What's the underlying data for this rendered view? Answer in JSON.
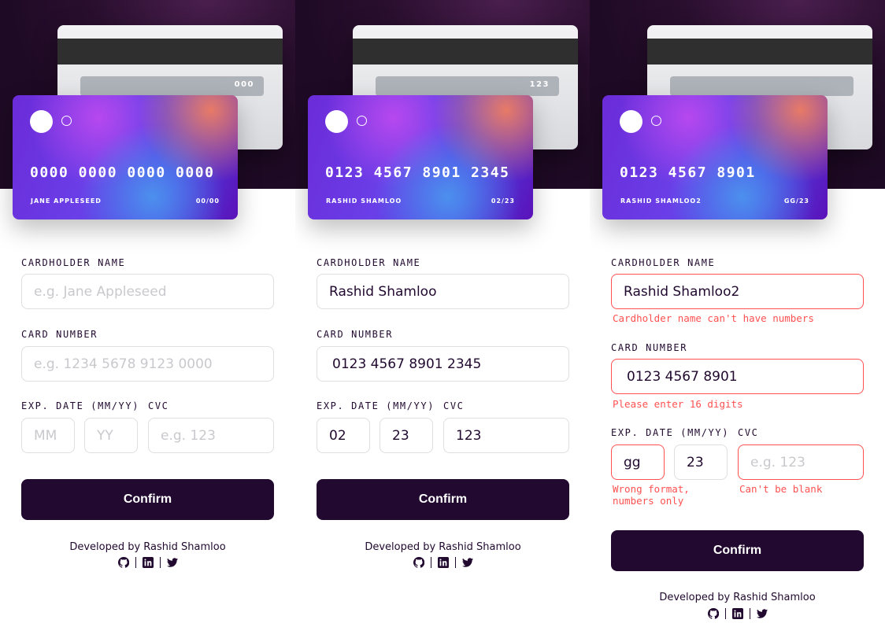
{
  "panels": [
    {
      "card_back_cvc": "000",
      "card_number": "0000 0000 0000 0000",
      "card_holder": "JANE APPLESEED",
      "card_expiry": "00/00",
      "name_label": "CARDHOLDER NAME",
      "name_value": "",
      "name_placeholder": "e.g. Jane Appleseed",
      "number_label": "CARD NUMBER",
      "number_value": "",
      "number_placeholder": "e.g. 1234 5678 9123 0000",
      "exp_label": "EXP. DATE (MM/YY)",
      "mm_value": "",
      "mm_placeholder": "MM",
      "yy_value": "",
      "yy_placeholder": "YY",
      "cvc_label": "CVC",
      "cvc_value": "",
      "cvc_placeholder": "e.g. 123",
      "confirm_label": "Confirm",
      "footer_text": "Developed by Rashid Shamloo"
    },
    {
      "card_back_cvc": "123",
      "card_number": "0123 4567 8901 2345",
      "card_holder": "RASHID SHAMLOO",
      "card_expiry": "02/23",
      "name_label": "CARDHOLDER NAME",
      "name_value": "Rashid Shamloo",
      "number_label": "CARD NUMBER",
      "number_value": "0123 4567 8901 2345",
      "exp_label": "EXP. DATE (MM/YY)",
      "mm_value": "02",
      "yy_value": "23",
      "cvc_label": "CVC",
      "cvc_value": "123",
      "confirm_label": "Confirm",
      "footer_text": "Developed by Rashid Shamloo"
    },
    {
      "card_back_cvc": "",
      "card_number": "0123 4567 8901",
      "card_holder": "RASHID SHAMLOO2",
      "card_expiry": "GG/23",
      "name_label": "CARDHOLDER NAME",
      "name_value": "Rashid Shamloo2",
      "name_error": "Cardholder name can't have numbers",
      "number_label": "CARD NUMBER",
      "number_value": "0123 4567 8901",
      "number_error": "Please enter 16 digits",
      "exp_label": "EXP. DATE (MM/YY)",
      "mm_value": "gg",
      "yy_value": "23",
      "exp_error": "Wrong format, numbers only",
      "cvc_label": "CVC",
      "cvc_value": "",
      "cvc_placeholder": "e.g. 123",
      "cvc_error": "Can't be blank",
      "confirm_label": "Confirm",
      "footer_text": "Developed by Rashid Shamloo"
    }
  ],
  "socials": [
    "github-icon",
    "linkedin-icon",
    "twitter-icon"
  ],
  "colors": {
    "accent": "#21092f",
    "error": "#ff5050",
    "hero_bg": "#2a0f2f",
    "field_border": "#dfdee0",
    "placeholder": "#c9c8cc"
  }
}
